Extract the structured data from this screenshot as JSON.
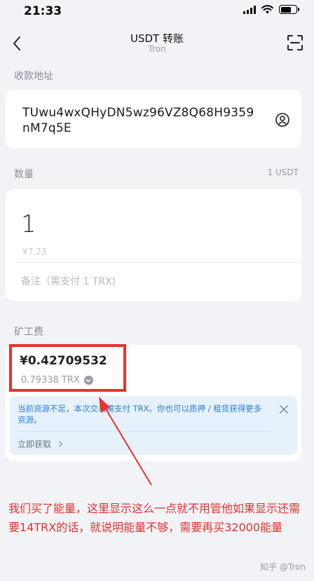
{
  "status": {
    "time": "21:33"
  },
  "header": {
    "title": "USDT 转账",
    "subtitle": "Tron"
  },
  "recipient": {
    "label": "收款地址",
    "address": "TUwu4wxQHyDN5wz96VZ8Q68H9359nM7q5E"
  },
  "amount": {
    "label": "数量",
    "unit": "1 USDT",
    "value": "1",
    "fiat": "¥7.23",
    "memo_placeholder": "备注（需支付 1 TRX)"
  },
  "fee": {
    "label": "矿工费",
    "value": "¥0.42709532",
    "trx": "0.79338 TRX",
    "notice": "当前资源不足，本次交易需支付 TRX。你也可以质押 / 租赁获得更多资源。",
    "action": "立即获取"
  },
  "annotation": "我们买了能量，这里显示这么一点就不用管他如果显示还需要14TRX的话，就说明能量不够，需要再买32000能量",
  "watermark": "知乎 @Tron",
  "colors": {
    "accent_red": "#e8322d",
    "notice_blue": "#2a7fd4"
  }
}
